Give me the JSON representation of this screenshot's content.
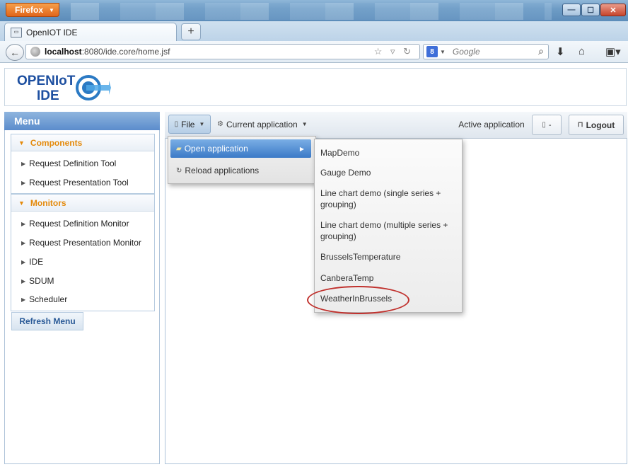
{
  "browser": {
    "app_button": "Firefox",
    "tab_title": "OpenIOT IDE",
    "url_host": "localhost",
    "url_path": ":8080/ide.core/home.jsf",
    "search_placeholder": "Google",
    "window_buttons": {
      "minimize": "—",
      "maximize": "☐",
      "close": "✕"
    }
  },
  "logo": {
    "line1": "OPENIoT",
    "line2": "IDE"
  },
  "menu": {
    "title": "Menu",
    "sections": [
      {
        "label": "Components",
        "items": [
          "Request Definition Tool",
          "Request Presentation Tool"
        ]
      },
      {
        "label": "Monitors",
        "items": [
          "Request Definition Monitor",
          "Request Presentation Monitor",
          "IDE",
          "SDUM",
          "Scheduler"
        ]
      }
    ],
    "refresh_label": "Refresh Menu"
  },
  "toolbar": {
    "file_label": "File",
    "current_app_label": "Current application",
    "active_app_label": "Active application",
    "doc_label": "-",
    "logout_label": "Logout"
  },
  "file_menu": {
    "open_label": "Open application",
    "reload_label": "Reload applications"
  },
  "applications": [
    "MapDemo",
    "Gauge Demo",
    "Line chart demo (single series + grouping)",
    "Line chart demo (multiple series + grouping)",
    "BrusselsTemperature",
    "CanberaTemp",
    "WeatherInBrussels"
  ],
  "highlight": {
    "color": "#c0302c"
  }
}
